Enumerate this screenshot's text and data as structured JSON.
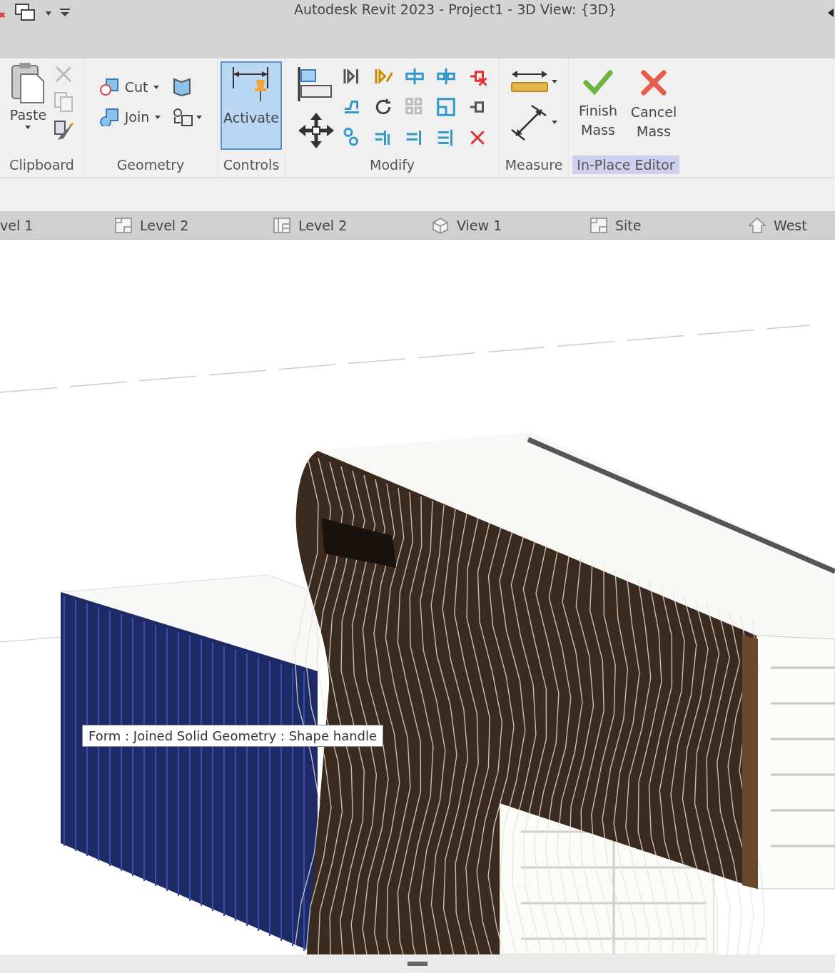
{
  "window": {
    "title": "Autodesk Revit 2023 - Project1 - 3D View: {3D}"
  },
  "ribbon": {
    "panels": [
      {
        "kind": "clipboard",
        "label": "Clipboard",
        "paste": "Paste"
      },
      {
        "kind": "geometry",
        "label": "Geometry",
        "cut": "Cut",
        "join": "Join"
      },
      {
        "kind": "controls",
        "label": "Controls",
        "activate": "Activate",
        "selected": true
      },
      {
        "kind": "modify",
        "label": "Modify"
      },
      {
        "kind": "measure",
        "label": "Measure"
      },
      {
        "kind": "editor",
        "label": "In-Place Editor",
        "highlighted": true,
        "finish": "Finish Mass",
        "cancel": "Cancel Mass"
      }
    ]
  },
  "view_tabs": [
    {
      "label": "vel 1"
    },
    {
      "label": "Level 2",
      "kind": "plan"
    },
    {
      "label": "Level 2",
      "kind": "ceiling"
    },
    {
      "label": "View 1",
      "kind": "isometric"
    },
    {
      "label": "Site",
      "kind": "plan"
    },
    {
      "label": "West",
      "kind": "elevation"
    }
  ],
  "tooltip": {
    "text": "Form : Joined Solid Geometry : Shape handle"
  }
}
